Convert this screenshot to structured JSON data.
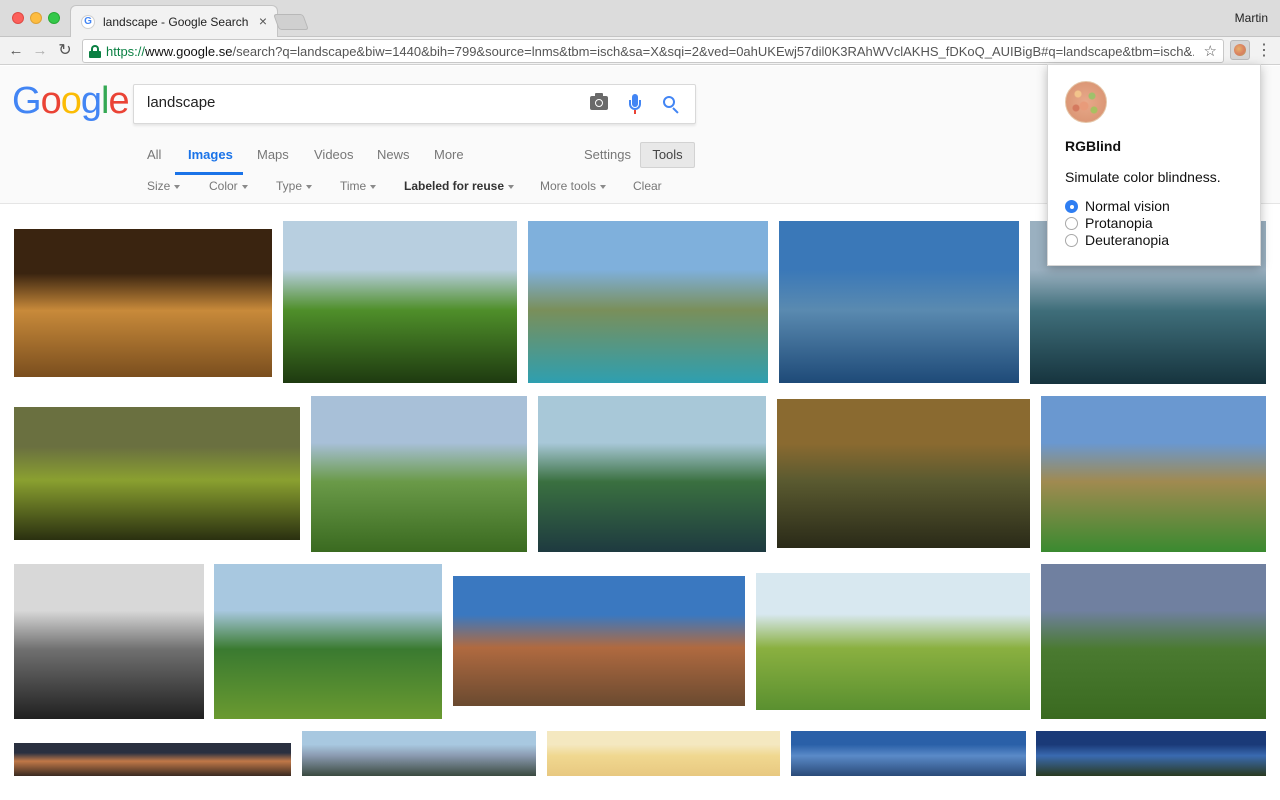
{
  "window": {
    "tab_title": "landscape - Google Search",
    "tab_favicon": "G",
    "tab_close": "×",
    "profile_name": "Martin"
  },
  "toolbar": {
    "back_icon": "←",
    "forward_icon": "→",
    "reload_icon": "↻",
    "url_scheme": "https://",
    "url_host": "www.google.se",
    "url_rest": "/search?q=landscape&biw=1440&bih=799&source=lnms&tbm=isch&sa=X&sqi=2&ved=0ahUKEwj57dil0K3RAhWVclAKHS_fDKoQ_AUIBigB#q=landscape&tbm=isch&...",
    "star_icon": "☆",
    "menu_icon": "⋮"
  },
  "google": {
    "logo_letters": [
      {
        "ch": "G",
        "color": "#4285f4"
      },
      {
        "ch": "o",
        "color": "#ea4335"
      },
      {
        "ch": "o",
        "color": "#fbbc05"
      },
      {
        "ch": "g",
        "color": "#4285f4"
      },
      {
        "ch": "l",
        "color": "#34a853"
      },
      {
        "ch": "e",
        "color": "#ea4335"
      }
    ],
    "search_value": "landscape",
    "tabs": [
      "All",
      "Images",
      "Maps",
      "Videos",
      "News",
      "More"
    ],
    "active_tab": "Images",
    "settings_label": "Settings",
    "tools_label": "Tools",
    "tool_items": [
      "Size",
      "Color",
      "Type",
      "Time",
      "Labeled for reuse",
      "More tools"
    ],
    "clear_label": "Clear"
  },
  "images": [
    {
      "desc": "sunset valley",
      "colors": [
        "#3a2410",
        "#c88a3a",
        "#7a4e1e"
      ]
    },
    {
      "desc": "green meadow with trees",
      "colors": [
        "#b8cfe0",
        "#4f8f2a",
        "#1e3a10"
      ]
    },
    {
      "desc": "alpine lake",
      "colors": [
        "#7fb0dc",
        "#7a8f5a",
        "#2e9fb0"
      ]
    },
    {
      "desc": "mountain lake reflection",
      "colors": [
        "#3a78b8",
        "#5a8ab0",
        "#1e4a78"
      ]
    },
    {
      "desc": "fjord",
      "colors": [
        "#9ab0c0",
        "#3f6e7a",
        "#16343e"
      ]
    },
    {
      "desc": "sunlit hills",
      "colors": [
        "#6a7040",
        "#8aa030",
        "#2a3010"
      ]
    },
    {
      "desc": "green valley clouds",
      "colors": [
        "#a8c0d8",
        "#6a9a48",
        "#3a6a20"
      ]
    },
    {
      "desc": "lake mirror mountains",
      "colors": [
        "#a8c8d8",
        "#3a7040",
        "#1e3a40"
      ]
    },
    {
      "desc": "misty village",
      "colors": [
        "#8a6a30",
        "#5a5a30",
        "#2a2a18"
      ]
    },
    {
      "desc": "golden hills",
      "colors": [
        "#6a98d0",
        "#a08a50",
        "#3a8a30"
      ]
    },
    {
      "desc": "black and white river",
      "colors": [
        "#d8d8d8",
        "#707070",
        "#202020"
      ]
    },
    {
      "desc": "park with trees",
      "colors": [
        "#a8c8e0",
        "#3a7a30",
        "#6a9a30"
      ]
    },
    {
      "desc": "stone arch",
      "colors": [
        "#3a78c0",
        "#b06a40",
        "#6a4a30"
      ]
    },
    {
      "desc": "rolling green hills",
      "colors": [
        "#d8e8f0",
        "#8ab040",
        "#5a9030"
      ]
    },
    {
      "desc": "cloudy grassland",
      "colors": [
        "#7080a0",
        "#4a7a30",
        "#3a6a20"
      ]
    },
    {
      "desc": "dusk sky",
      "colors": [
        "#2a3040",
        "#c07848",
        "#3a2a20"
      ]
    },
    {
      "desc": "snowy peak",
      "colors": [
        "#a8c8e0",
        "#8a9ab0",
        "#3a4a40"
      ]
    },
    {
      "desc": "pale yellow sky",
      "colors": [
        "#f4e8c0",
        "#f0d890",
        "#e8c880"
      ]
    },
    {
      "desc": "blue sky clouds",
      "colors": [
        "#2a60a8",
        "#5a8ac8",
        "#2a4a78"
      ]
    },
    {
      "desc": "deep blue horizon",
      "colors": [
        "#1a3a78",
        "#3a6ab0",
        "#2a3a20"
      ]
    }
  ],
  "popup": {
    "title": "RGBlind",
    "description": "Simulate color blindness.",
    "options": [
      "Normal vision",
      "Protanopia",
      "Deuteranopia"
    ],
    "selected": "Normal vision"
  }
}
